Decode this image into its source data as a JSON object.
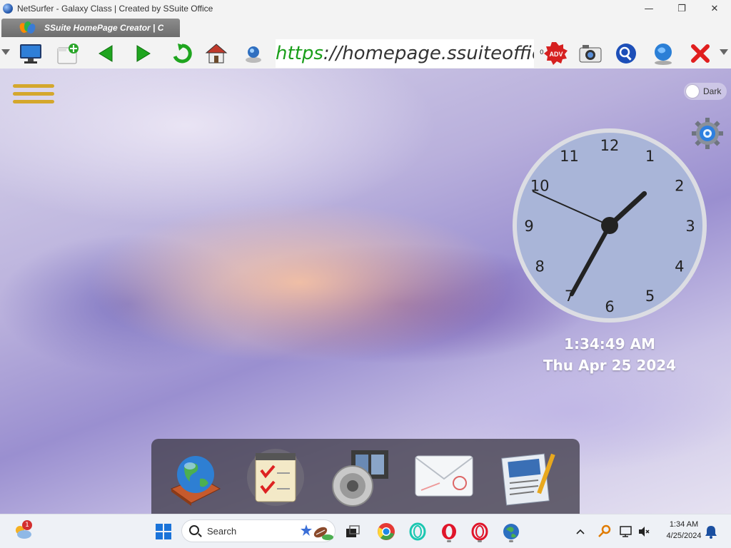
{
  "window": {
    "title": "NetSurfer - Galaxy Class | Created by SSuite Office",
    "minimize": "—",
    "maximize": "❐",
    "close": "✕"
  },
  "tab": {
    "label": "SSuite HomePage Creator | C"
  },
  "toolbar": {
    "url_protocol": "https",
    "url_rest": "://homepage.ssuiteoffice.com/",
    "tiny_text": "0",
    "icons": [
      "monitor-icon",
      "new-tab-icon",
      "back-icon",
      "forward-icon",
      "reload-icon",
      "home-icon",
      "user-icon",
      "adblock-icon",
      "camera-icon",
      "search-icon",
      "globe-icon",
      "close-icon"
    ]
  },
  "desktop": {
    "dark_toggle_label": "Dark",
    "clock": {
      "numbers": [
        "12",
        "1",
        "2",
        "3",
        "4",
        "5",
        "6",
        "7",
        "8",
        "9",
        "10",
        "11"
      ],
      "hours": 1,
      "minutes": 34,
      "seconds": 49
    },
    "time_text": "1:34:49 AM",
    "date_text": "Thu Apr 25 2024",
    "dock_items": [
      "globe-book-icon",
      "notepad-checklist-icon",
      "media-speaker-icon",
      "mail-envelope-icon",
      "document-writer-icon"
    ]
  },
  "taskbar": {
    "weather_badge": "1",
    "search_text": "Search",
    "tray_time": "1:34 AM",
    "tray_date": "4/25/2024"
  },
  "colors": {
    "url_protocol": "#1a9e1a",
    "hamburger": "#d4a72c",
    "dock": "#3c3846"
  }
}
